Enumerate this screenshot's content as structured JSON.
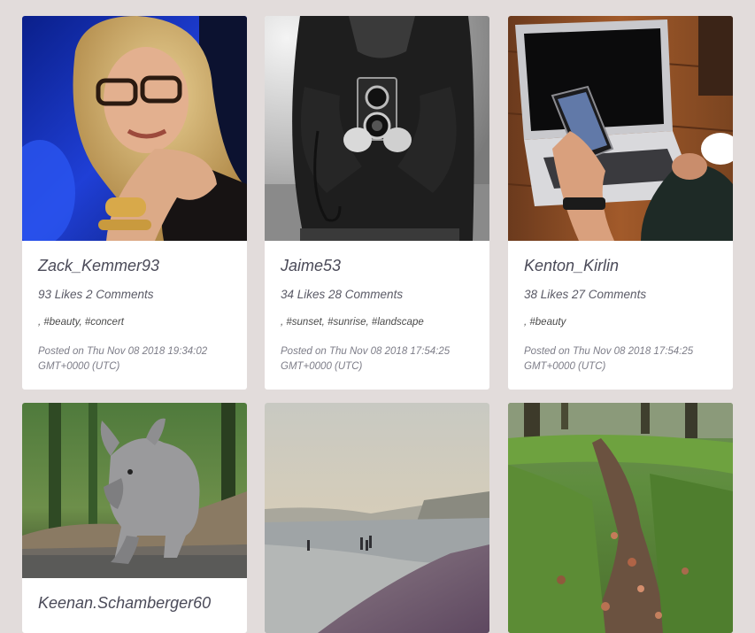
{
  "posts": [
    {
      "username": "Zack_Kemmer93",
      "stats": "93 Likes 2 Comments",
      "tags": [
        ", ",
        "#beauty",
        ", ",
        "#concert"
      ],
      "posted": "Posted on Thu Nov 08 2018 19:34:02 GMT+0000 (UTC)",
      "image": "woman-with-glasses-photo"
    },
    {
      "username": "Jaime53",
      "stats": "34 Likes 28 Comments",
      "tags": [
        ", ",
        "#sunset",
        ", ",
        "#sunrise",
        ", ",
        "#landscape"
      ],
      "posted": "Posted on Thu Nov 08 2018 17:54:25 GMT+0000 (UTC)",
      "image": "man-with-vintage-camera-photo"
    },
    {
      "username": "Kenton_Kirlin",
      "stats": "38 Likes 27 Comments",
      "tags": [
        ", ",
        "#beauty"
      ],
      "posted": "Posted on Thu Nov 08 2018 17:54:25 GMT+0000 (UTC)",
      "image": "laptop-and-phone-photo"
    },
    {
      "username": "Keenan.Schamberger60",
      "image": "baby-rhino-photo"
    },
    {
      "image": "misty-beach-photo"
    },
    {
      "image": "forest-path-photo"
    }
  ]
}
